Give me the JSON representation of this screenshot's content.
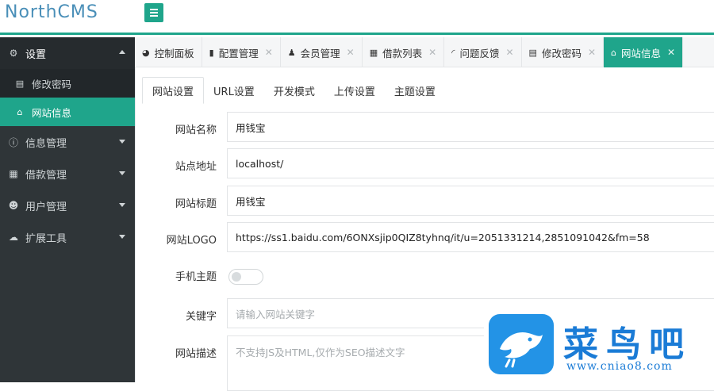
{
  "app": {
    "brand": "NorthCMS"
  },
  "sidebar": {
    "groups": [
      {
        "label": "设置",
        "icon": "cogs-icon",
        "open": true
      },
      {
        "label": "信息管理",
        "icon": "info-icon"
      },
      {
        "label": "借款管理",
        "icon": "calendar-icon"
      },
      {
        "label": "用户管理",
        "icon": "users-icon"
      },
      {
        "label": "扩展工具",
        "icon": "cloud-icon"
      }
    ],
    "subitems": [
      {
        "label": "修改密码",
        "icon": "id-card-icon"
      },
      {
        "label": "网站信息",
        "icon": "home-icon",
        "active": true
      }
    ]
  },
  "tabs": [
    {
      "label": "控制面板",
      "icon": "dashboard-icon",
      "closable": false
    },
    {
      "label": "配置管理",
      "icon": "database-icon",
      "closable": true
    },
    {
      "label": "会员管理",
      "icon": "user-icon",
      "closable": true
    },
    {
      "label": "借款列表",
      "icon": "calendar-icon",
      "closable": true
    },
    {
      "label": "问题反馈",
      "icon": "rss-icon",
      "closable": true
    },
    {
      "label": "修改密码",
      "icon": "id-card-icon",
      "closable": true
    },
    {
      "label": "网站信息",
      "icon": "home-icon",
      "closable": true,
      "active": true
    }
  ],
  "subtabs": [
    "网站设置",
    "URL设置",
    "开发模式",
    "上传设置",
    "主题设置"
  ],
  "form": {
    "site_name": {
      "label": "网站名称",
      "value": "用钱宝"
    },
    "site_url": {
      "label": "站点地址",
      "value": "localhost/"
    },
    "site_title": {
      "label": "网站标题",
      "value": "用钱宝"
    },
    "site_logo": {
      "label": "网站LOGO",
      "value": "https://ss1.baidu.com/6ONXsjip0QIZ8tyhnq/it/u=2051331214,2851091042&fm=58"
    },
    "mobile_theme": {
      "label": "手机主题",
      "enabled": false
    },
    "keywords": {
      "label": "关键字",
      "placeholder": "请输入网站关键字"
    },
    "description": {
      "label": "网站描述",
      "placeholder": "不支持JS及HTML,仅作为SEO描述文字"
    }
  },
  "watermark": {
    "title": "菜鸟吧",
    "url": "www.cniao8.com"
  },
  "colors": {
    "accent": "#1fa58b",
    "sidebar": "#2f3538",
    "brand_text": "#4a8fb8"
  }
}
